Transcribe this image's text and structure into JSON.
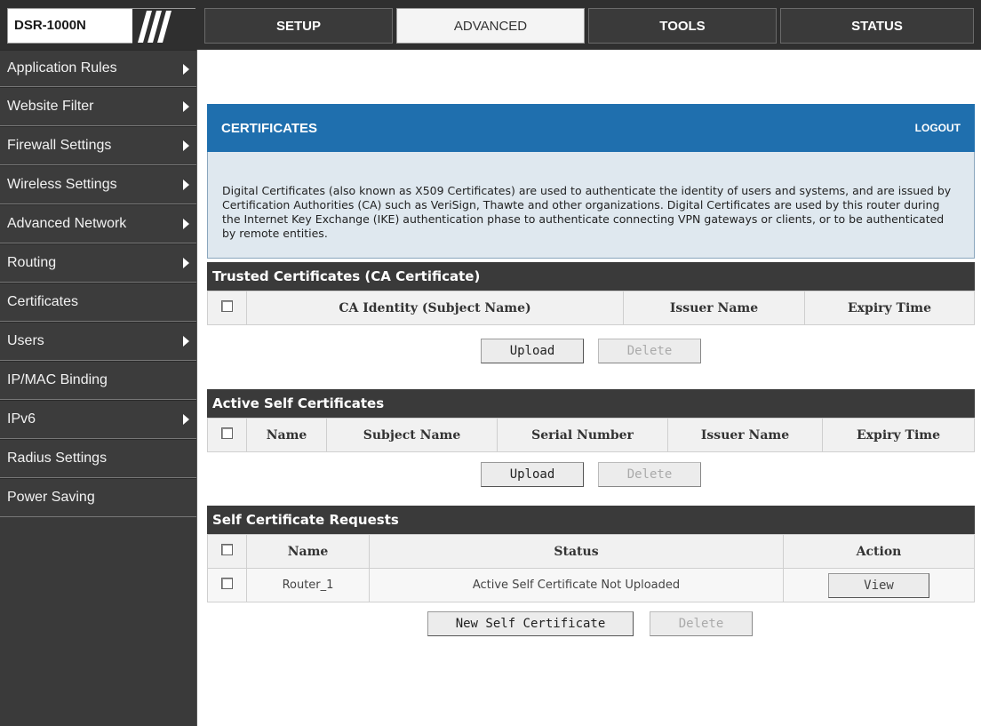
{
  "brand": {
    "label": "DSR-1000N"
  },
  "tabs": [
    {
      "label": "SETUP",
      "active": false
    },
    {
      "label": "ADVANCED",
      "active": true
    },
    {
      "label": "TOOLS",
      "active": false
    },
    {
      "label": "STATUS",
      "active": false
    }
  ],
  "sidebar": {
    "items": [
      {
        "label": "Application Rules",
        "has_arrow": true
      },
      {
        "label": "Website Filter",
        "has_arrow": true
      },
      {
        "label": "Firewall Settings",
        "has_arrow": true
      },
      {
        "label": "Wireless Settings",
        "has_arrow": true
      },
      {
        "label": "Advanced Network",
        "has_arrow": true
      },
      {
        "label": "Routing",
        "has_arrow": true
      },
      {
        "label": "Certificates",
        "has_arrow": false
      },
      {
        "label": "Users",
        "has_arrow": true
      },
      {
        "label": "IP/MAC Binding",
        "has_arrow": false
      },
      {
        "label": "IPv6",
        "has_arrow": true
      },
      {
        "label": "Radius Settings",
        "has_arrow": false
      },
      {
        "label": "Power Saving",
        "has_arrow": false
      }
    ]
  },
  "page": {
    "title": "CERTIFICATES",
    "logout": "LOGOUT",
    "description": "Digital Certificates (also known as X509 Certificates) are used to authenticate the identity of users and systems, and are issued by Certification Authorities (CA) such as VeriSign, Thawte and other organizations. Digital Certificates are used by this router during the Internet Key Exchange (IKE) authentication phase to authenticate connecting VPN gateways or clients, or to be authenticated by remote entities."
  },
  "trusted": {
    "title": "Trusted Certificates (CA Certificate)",
    "columns": [
      "CA Identity (Subject Name)",
      "Issuer Name",
      "Expiry Time"
    ],
    "upload": "Upload",
    "delete": "Delete"
  },
  "active_self": {
    "title": "Active Self Certificates",
    "columns": [
      "Name",
      "Subject Name",
      "Serial Number",
      "Issuer Name",
      "Expiry Time"
    ],
    "upload": "Upload",
    "delete": "Delete"
  },
  "requests": {
    "title": "Self Certificate Requests",
    "columns": [
      "Name",
      "Status",
      "Action"
    ],
    "rows": [
      {
        "name": "Router_1",
        "status": "Active Self Certificate Not Uploaded",
        "action": "View"
      }
    ],
    "new": "New Self Certificate",
    "delete": "Delete"
  },
  "colors": {
    "nav_bg": "#2f2f2f",
    "header_blue": "#1f6fae",
    "desc_bg": "#dfe8ef"
  }
}
